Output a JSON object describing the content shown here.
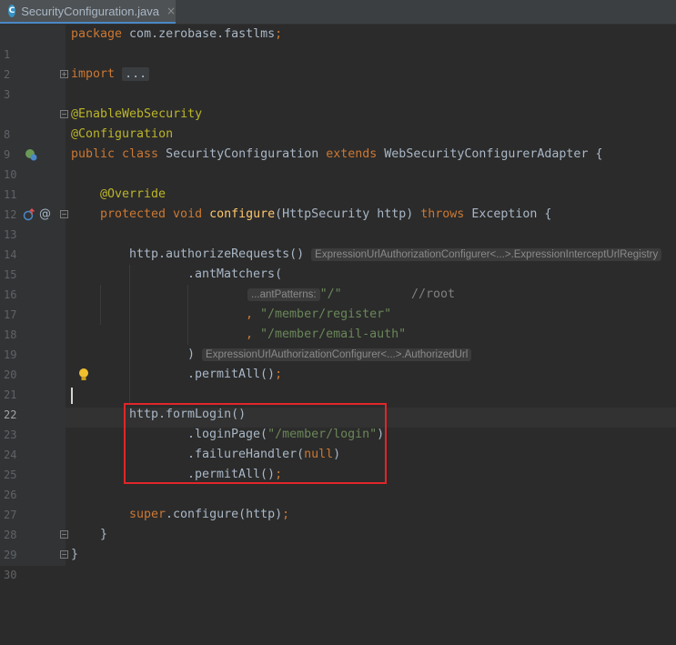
{
  "tab": {
    "label": "SecurityConfiguration.java",
    "icon_letter": "C",
    "close": "×"
  },
  "lines": [
    {
      "n": "1",
      "text": [
        "package com.zerobase.fastlms;"
      ]
    },
    {
      "n": "2"
    },
    {
      "n": "3",
      "import_kw": "import",
      "import_collapsed": "..."
    },
    {
      "n": "8",
      "ann": "@EnableWebSecurity"
    },
    {
      "n": "9",
      "ann": "@Configuration"
    },
    {
      "n": "10",
      "kw1": "public class",
      "name": "SecurityConfiguration",
      "kw2": "extends",
      "parent": "WebSecurityConfigurerAdapter {"
    },
    {
      "n": "11"
    },
    {
      "n": "12",
      "ann": "@Override"
    },
    {
      "n": "13",
      "kw1": "protected void",
      "fn": "configure",
      "params": "(HttpSecurity http)",
      "kw2": "throws",
      "rest": "Exception {"
    },
    {
      "n": "14"
    },
    {
      "n": "15",
      "code": "http.authorizeRequests()",
      "hint": "ExpressionUrlAuthorizationConfigurer<...>.ExpressionInterceptUrlRegistry"
    },
    {
      "n": "16",
      "code": ".antMatchers("
    },
    {
      "n": "17",
      "hint": "...antPatterns:",
      "str": "\"/\"",
      "cmt": "//root"
    },
    {
      "n": "18",
      "comma": ",",
      "str": "\"/member/register\""
    },
    {
      "n": "19",
      "comma": ",",
      "str": "\"/member/email-auth\""
    },
    {
      "n": "20",
      "code": ")",
      "hint": "ExpressionUrlAuthorizationConfigurer<...>.AuthorizedUrl"
    },
    {
      "n": "21",
      "code": ".permitAll()",
      "semi": ";"
    },
    {
      "n": "22"
    },
    {
      "n": "23",
      "code": "http.formLogin()"
    },
    {
      "n": "24",
      "code": ".loginPage(",
      "str": "\"/member/login\"",
      "close": ")"
    },
    {
      "n": "25",
      "code": ".failureHandler(",
      "kw": "null",
      "close": ")"
    },
    {
      "n": "26",
      "code": ".permitAll()",
      "semi": ";"
    },
    {
      "n": "27"
    },
    {
      "n": "28",
      "kw": "super",
      "code": ".configure(http)",
      "semi": ";"
    },
    {
      "n": "29",
      "code": "}"
    },
    {
      "n": "30",
      "code": "}"
    }
  ],
  "colors": {
    "background": "#2b2b2b",
    "keyword": "#cc7832",
    "annotation": "#bbb529",
    "string": "#6a8759",
    "comment": "#808080",
    "method": "#ffc66d",
    "text": "#a9b7c6",
    "highlight_box": "#e0262a"
  },
  "icons": {
    "line10": "bean-class-icon",
    "line13_override": "override-method-icon",
    "line13_at": "at-annotation-icon",
    "line21": "lightbulb-intention-icon"
  }
}
